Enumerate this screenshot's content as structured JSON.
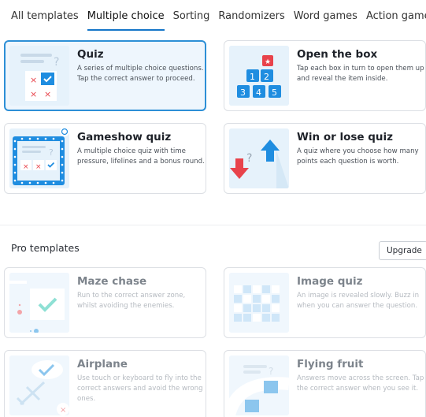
{
  "tabs": [
    {
      "label": "All templates"
    },
    {
      "label": "Multiple choice"
    },
    {
      "label": "Sorting"
    },
    {
      "label": "Randomizers"
    },
    {
      "label": "Word games"
    },
    {
      "label": "Action games"
    }
  ],
  "active_tab": "Multiple choice",
  "templates": [
    {
      "title": "Quiz",
      "desc": "A series of multiple choice questions. Tap the correct answer to proceed.",
      "selected": true
    },
    {
      "title": "Open the box",
      "desc": "Tap each box in turn to open them up and reveal the item inside."
    },
    {
      "title": "Gameshow quiz",
      "desc": "A multiple choice quiz with time pressure, lifelines and a bonus round."
    },
    {
      "title": "Win or lose quiz",
      "desc": "A quiz where you choose how many points each question is worth."
    }
  ],
  "box_numbers": [
    "1",
    "2",
    "3",
    "4",
    "5"
  ],
  "pro": {
    "heading": "Pro templates",
    "upgrade_label": "Upgrade",
    "items": [
      {
        "title": "Maze chase",
        "desc": "Run to the correct answer zone, whilst avoiding the enemies."
      },
      {
        "title": "Image quiz",
        "desc": "An image is revealed slowly. Buzz in when you can answer the question."
      },
      {
        "title": "Airplane",
        "desc": "Use touch or keyboard to fly into the correct answers and avoid the wrong ones."
      },
      {
        "title": "Flying fruit",
        "desc": "Answers move across the screen. Tap the correct answer when you see it."
      }
    ]
  },
  "colors": {
    "accent": "#1576c8",
    "selected_border": "#2d8fd6",
    "tile_blue": "#1f8de0",
    "wrong_red": "#e8434b",
    "correct_teal": "#3cc7b4"
  }
}
